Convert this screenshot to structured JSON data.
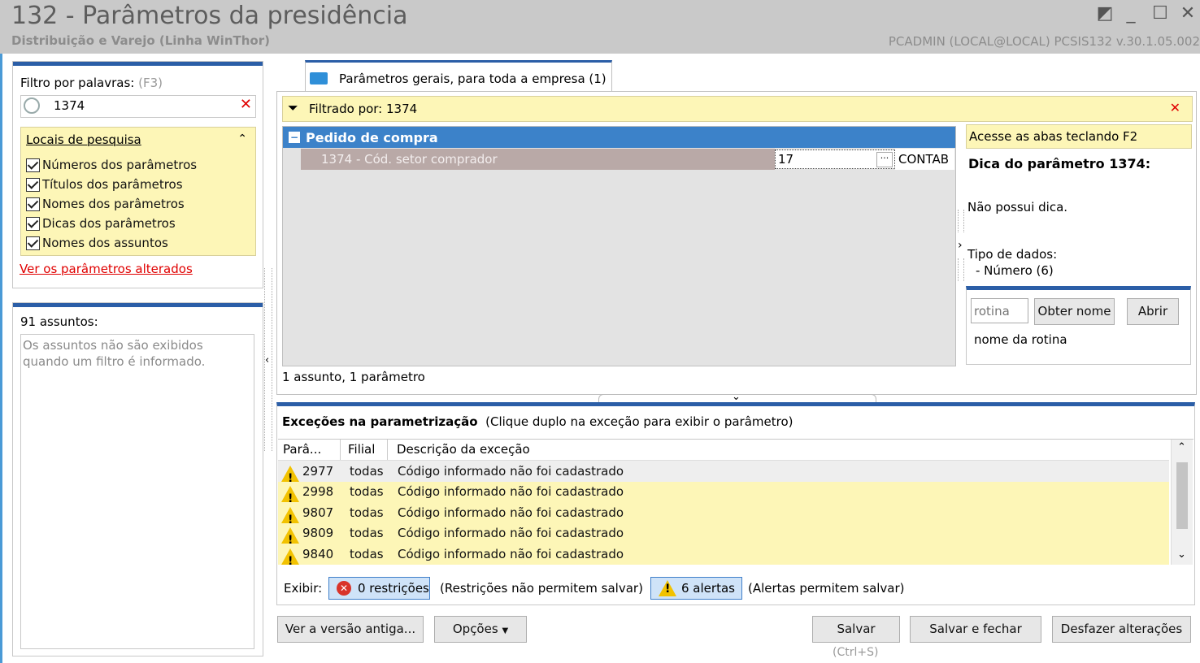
{
  "window": {
    "title": "132 - Parâmetros da presidência",
    "subtitle": "Distribuição e Varejo (Linha WinThor)",
    "user_info": "PCADMIN (LOCAL@LOCAL)   PCSIS132  v.30.1.05.002"
  },
  "filter": {
    "label": "Filtro por palavras:",
    "shortcut": "(F3)",
    "value": "1374",
    "locations_title": "Locais de pesquisa",
    "options": [
      "Números dos parâmetros",
      "Títulos dos parâmetros",
      "Nomes dos parâmetros",
      "Dicas dos parâmetros",
      "Nomes dos assuntos"
    ],
    "changed_link": "Ver os parâmetros alterados"
  },
  "subjects": {
    "count_label": "91 assuntos:",
    "message": "Os assuntos não são exibidos quando um filtro é informado."
  },
  "tab": {
    "label": "Parâmetros gerais, para toda a empresa  (1)"
  },
  "filtered_bar": {
    "text": "Filtrado por: 1374"
  },
  "grid": {
    "group": "Pedido de compra",
    "param_label": "1374 - Cód. setor comprador",
    "param_value": "17",
    "param_extra": "CONTAB",
    "summary": "1 assunto, 1 parâmetro"
  },
  "hint": {
    "banner": "Acesse as abas teclando F2",
    "title": "Dica do parâmetro 1374:",
    "text": "Não possui dica.",
    "type_label": "Tipo de dados:",
    "type_value": "- Número (6)",
    "rotina_placeholder": "rotina",
    "get_name_button": "Obter nome",
    "open_button": "Abrir",
    "rotina_name": "nome da rotina"
  },
  "exceptions": {
    "title": "Exceções na parametrização",
    "subtitle": "(Clique duplo na exceção para exibir o parâmetro)",
    "columns": [
      "Parâ...",
      "Filial",
      "Descrição da exceção"
    ],
    "rows": [
      {
        "param": "2977",
        "filial": "todas",
        "desc": "Código informado não foi cadastrado"
      },
      {
        "param": "2998",
        "filial": "todas",
        "desc": "Código informado não foi cadastrado"
      },
      {
        "param": "9807",
        "filial": "todas",
        "desc": "Código informado não foi cadastrado"
      },
      {
        "param": "9809",
        "filial": "todas",
        "desc": "Código informado não foi cadastrado"
      },
      {
        "param": "9840",
        "filial": "todas",
        "desc": "Código informado não foi cadastrado"
      }
    ],
    "show_label": "Exibir:",
    "restrictions_button": "0 restrições",
    "restrictions_note": "(Restrições não permitem salvar)",
    "alerts_button": "6 alertas",
    "alerts_note": "(Alertas permitem salvar)"
  },
  "footer": {
    "old_version": "Ver a versão antiga...",
    "options": "Opções",
    "save": "Salvar",
    "save_shortcut": "(Ctrl+S)",
    "save_close": "Salvar e fechar",
    "undo": "Desfazer alterações"
  },
  "colors": {
    "accent_blue": "#2b5ea7",
    "highlight_yellow": "#fdf6b7",
    "title_gray": "#c9c9c9"
  }
}
